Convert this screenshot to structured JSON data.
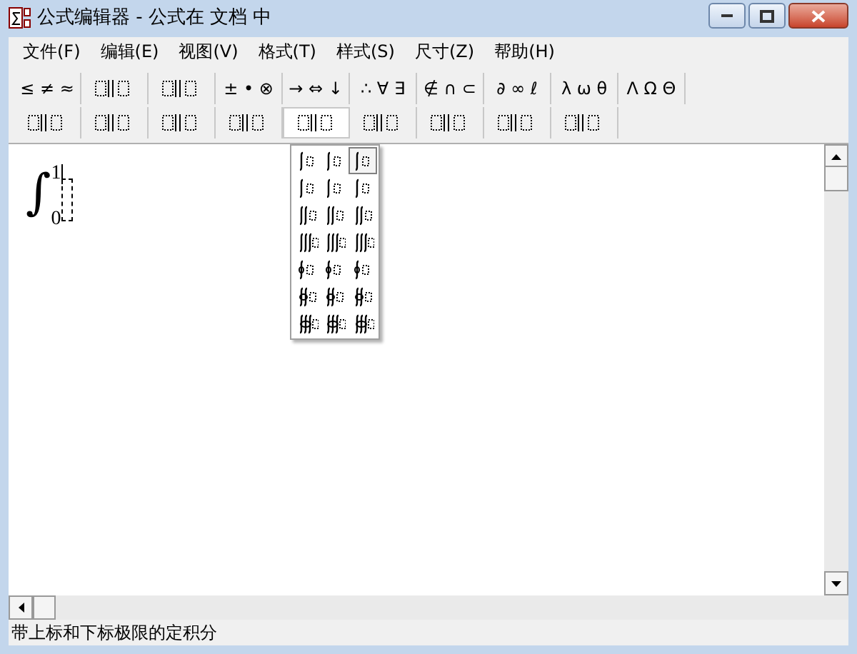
{
  "window": {
    "title": "公式编辑器 - 公式在 文档  中"
  },
  "menu": [
    "文件(F)",
    "编辑(E)",
    "视图(V)",
    "格式(T)",
    "样式(S)",
    "尺寸(Z)",
    "帮助(H)"
  ],
  "toolbar_rows": [
    [
      {
        "kind": "text",
        "label": "≤ ≠ ≈"
      },
      {
        "kind": "template"
      },
      {
        "kind": "template"
      },
      {
        "kind": "text",
        "label": "± • ⊗"
      },
      {
        "kind": "text",
        "label": "→ ⇔ ↓"
      },
      {
        "kind": "text",
        "label": "∴ ∀ ∃"
      },
      {
        "kind": "text",
        "label": "∉ ∩ ⊂"
      },
      {
        "kind": "text",
        "label": "∂ ∞ ℓ"
      },
      {
        "kind": "text",
        "label": "λ ω θ"
      },
      {
        "kind": "text",
        "label": "Λ Ω Θ"
      }
    ],
    [
      {
        "kind": "template"
      },
      {
        "kind": "template"
      },
      {
        "kind": "template"
      },
      {
        "kind": "template"
      },
      {
        "kind": "template",
        "open": true
      },
      {
        "kind": "template"
      },
      {
        "kind": "template"
      },
      {
        "kind": "template"
      },
      {
        "kind": "template"
      }
    ]
  ],
  "integral_menu": [
    {
      "kind": "single",
      "selected": false
    },
    {
      "kind": "single",
      "selected": false
    },
    {
      "kind": "single",
      "selected": true
    },
    {
      "kind": "single",
      "selected": false
    },
    {
      "kind": "single",
      "selected": false
    },
    {
      "kind": "single",
      "selected": false
    },
    {
      "kind": "double",
      "selected": false
    },
    {
      "kind": "double",
      "selected": false
    },
    {
      "kind": "double",
      "selected": false
    },
    {
      "kind": "triple",
      "selected": false
    },
    {
      "kind": "triple",
      "selected": false
    },
    {
      "kind": "triple",
      "selected": false
    },
    {
      "kind": "contour",
      "selected": false
    },
    {
      "kind": "contour",
      "selected": false
    },
    {
      "kind": "contour",
      "selected": false
    },
    {
      "kind": "double-contour",
      "selected": false
    },
    {
      "kind": "double-contour",
      "selected": false
    },
    {
      "kind": "double-contour",
      "selected": false
    },
    {
      "kind": "triple-contour",
      "selected": false
    },
    {
      "kind": "triple-contour",
      "selected": false
    },
    {
      "kind": "triple-contour",
      "selected": false
    }
  ],
  "equation": {
    "symbol": "∫",
    "upper": "1",
    "lower": "0"
  },
  "status_bar": "带上标和下标极限的定积分"
}
